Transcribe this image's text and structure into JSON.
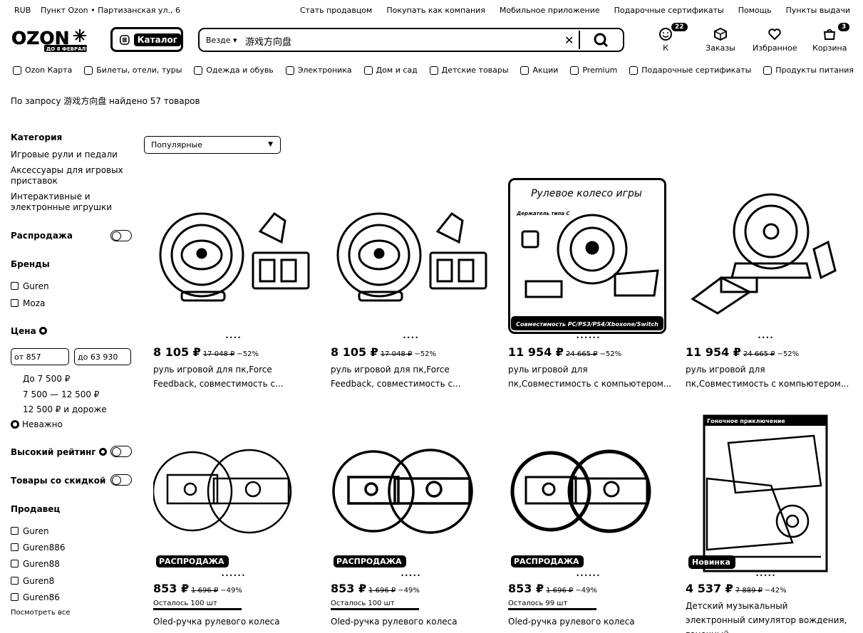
{
  "topbar": {
    "currency": "RUB",
    "pickup": "Пункт Ozon • Партизанская ул., 6",
    "links": [
      "Стать продавцом",
      "Покупать как компания",
      "Мобильное приложение",
      "Подарочные сертификаты",
      "Помощь",
      "Пункты выдачи"
    ]
  },
  "header": {
    "logo_text": "OZON",
    "logo_sub": "ДО 8 ФЕВРАЛЯ",
    "catalog_label": "Каталог",
    "search_scope": "Везде",
    "search_query": "游戏方向盘",
    "account": {
      "label": "К",
      "badge": "22"
    },
    "orders_label": "Заказы",
    "favorites_label": "Избранное",
    "cart": {
      "label": "Корзина",
      "badge": "3"
    }
  },
  "nav": [
    "Ozon Карта",
    "Билеты, отели, туры",
    "Одежда и обувь",
    "Электроника",
    "Дом и сад",
    "Детские товары",
    "Акции",
    "Premium",
    "Подарочные сертификаты",
    "Продукты питания"
  ],
  "result_text": "По запросу 游戏方向盘 найдено 57 товаров",
  "sidebar": {
    "category_title": "Категория",
    "categories": [
      "Игровые рули и педали",
      "Аксессуары для игровых приставок",
      "Интерактивные и электронные игрушки"
    ],
    "sale_label": "Распродажа",
    "brands_title": "Бренды",
    "brands": [
      "Guren",
      "Moza"
    ],
    "price_title": "Цена",
    "price_from": "от 857",
    "price_to": "до 63 930",
    "price_options": [
      "До 7 500 ₽",
      "7 500 — 12 500 ₽",
      "12 500 ₽ и дороже",
      "Неважно"
    ],
    "high_rating_label": "Высокий рейтинг",
    "discount_label": "Товары со скидкой",
    "seller_title": "Продавец",
    "sellers": [
      "Guren",
      "Guren886",
      "Guren88",
      "Guren8",
      "Guren86"
    ],
    "show_all": "Посмотреть все"
  },
  "sort": {
    "selected": "Популярные"
  },
  "products": [
    {
      "price": "8 105 ₽",
      "old": "17 048 ₽",
      "discount": "−52%",
      "title": "руль игровой для пк,Force Feedback, совместимость с...",
      "dots": "••••"
    },
    {
      "price": "8 105 ₽",
      "old": "17 048 ₽",
      "discount": "−52%",
      "title": "руль игровой для пк,Force Feedback, совместимость с...",
      "dots": "••••"
    },
    {
      "price": "11 954 ₽",
      "old": "24 665 ₽",
      "discount": "−52%",
      "title": "руль игровой для пк,Совместимость с компьютером...",
      "dots": "••••••",
      "img_caption": "Рулевое колесо игры",
      "img_sub": "Держатель типа С",
      "img_footer": "Совместимость PC/PS3/PS4/Xboxone/Switch"
    },
    {
      "price": "11 954 ₽",
      "old": "24 665 ₽",
      "discount": "−52%",
      "title": "руль игровой для пк,Совместимость с компьютером...",
      "dots": "••••"
    },
    {
      "price": "853 ₽",
      "old": "1 696 ₽",
      "discount": "−49%",
      "title": "Oled-ручка рулевого колеса",
      "stock": "Осталось 100 шт",
      "tag": "РАСПРОДАЖА",
      "dots": "••••••"
    },
    {
      "price": "853 ₽",
      "old": "1 696 ₽",
      "discount": "−49%",
      "title": "Oled-ручка рулевого колеса",
      "stock": "Осталось 100 шт",
      "tag": "РАСПРОДАЖА",
      "dots": "•••••"
    },
    {
      "price": "853 ₽",
      "old": "1 696 ₽",
      "discount": "−49%",
      "title": "Oled-ручка рулевого колеса",
      "stock": "Осталось 99 шт",
      "tag": "РАСПРОДАЖА",
      "dots": "••••••"
    },
    {
      "price": "4 537 ₽",
      "old": "7 889 ₽",
      "discount": "−42%",
      "title": "Детский музыкальный электронный симулятор вождения, гоночный...",
      "tag": "Новинка",
      "dots": "•••••",
      "img_caption": "Гоночное приключение"
    }
  ]
}
